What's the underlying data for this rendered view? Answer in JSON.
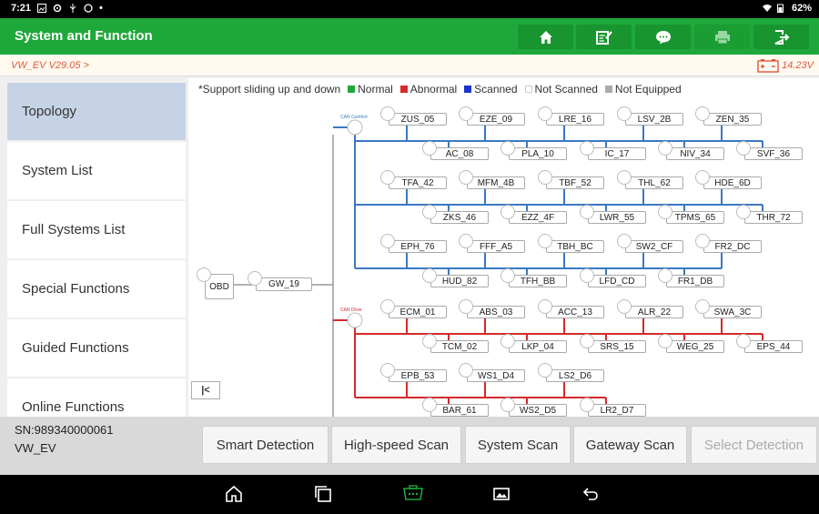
{
  "status": {
    "time": "7:21",
    "battery": "62%"
  },
  "header": {
    "title": "System and Function",
    "buttons": [
      {
        "icon": "home-icon"
      },
      {
        "icon": "edit-report-icon"
      },
      {
        "icon": "chat-icon"
      },
      {
        "icon": "print-icon",
        "disabled": true
      },
      {
        "icon": "exit-icon"
      }
    ]
  },
  "version": {
    "label": "VW_EV V29.05 >",
    "voltage": "14.23V"
  },
  "menu": [
    {
      "label": "Topology",
      "active": true
    },
    {
      "label": "System List"
    },
    {
      "label": "Full Systems List"
    },
    {
      "label": "Special Functions"
    },
    {
      "label": "Guided Functions"
    },
    {
      "label": "Online Functions"
    }
  ],
  "legend": {
    "hint": "*Support sliding up and down",
    "items": [
      {
        "label": "Normal",
        "color": "#1ea83a"
      },
      {
        "label": "Abnormal",
        "color": "#d42a2a"
      },
      {
        "label": "Scanned",
        "color": "#1c34c8"
      },
      {
        "label": "Not Scanned",
        "color": "#ffffff"
      },
      {
        "label": "Not Equipped",
        "color": "#aaaaaa"
      }
    ]
  },
  "topology": {
    "root": "OBD",
    "gateway": "GW_19",
    "bus_comfort": {
      "label": "CAN Comfort",
      "color": "#3a78c2"
    },
    "bus_drive": {
      "label": "CAN Drive",
      "color": "#d42a2a"
    },
    "comfort_rows": [
      [
        "ZUS_05",
        "EZE_09",
        "LRE_16",
        "LSV_2B",
        "ZEN_35"
      ],
      [
        "AC_08",
        "PLA_10",
        "IC_17",
        "NIV_34",
        "SVF_36"
      ],
      [
        "TFA_42",
        "MFM_4B",
        "TBF_52",
        "THL_62",
        "HDE_6D"
      ],
      [
        "ZKS_46",
        "EZZ_4F",
        "LWR_55",
        "TPMS_65",
        "THR_72"
      ],
      [
        "EPH_76",
        "FFF_A5",
        "TBH_BC",
        "SW2_CF",
        "FR2_DC"
      ],
      [
        "HUD_82",
        "TFH_BB",
        "LFD_CD",
        "FR1_DB"
      ]
    ],
    "drive_rows": [
      [
        "ECM_01",
        "ABS_03",
        "ACC_13",
        "ALR_22",
        "SWA_3C"
      ],
      [
        "TCM_02",
        "LKP_04",
        "SRS_15",
        "WEG_25",
        "EPS_44"
      ],
      [
        "EPB_53",
        "WS1_D4",
        "LS2_D6"
      ],
      [
        "BAR_61",
        "WS2_D5",
        "LR2_D7"
      ]
    ]
  },
  "device": {
    "sn": "SN:989340000061",
    "model": "VW_EV"
  },
  "actions": [
    {
      "label": "Smart Detection"
    },
    {
      "label": "High-speed Scan"
    },
    {
      "label": "System Scan"
    },
    {
      "label": "Gateway Scan"
    },
    {
      "label": "Select Detection",
      "disabled": true
    }
  ]
}
